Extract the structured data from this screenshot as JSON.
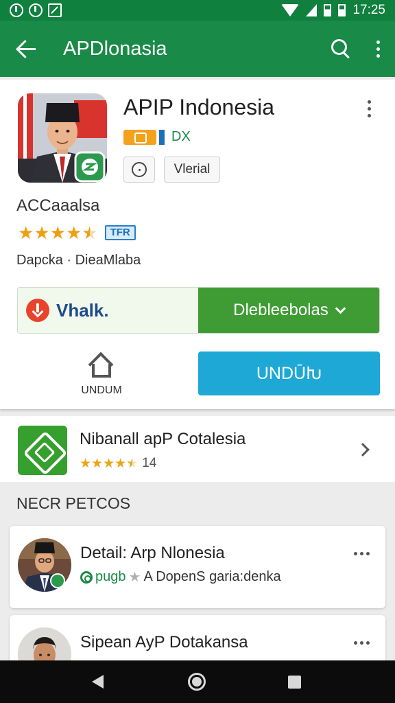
{
  "status_bar": {
    "time": "17:25"
  },
  "app_bar": {
    "title": "APDlonasia"
  },
  "app": {
    "title": "APIP Indonesia",
    "developer": "DX",
    "chip_text": "Vlerial",
    "rating_label": "ACCaaalsa",
    "stars": 4.5,
    "rating_badge": "TFR",
    "meta": "Dapcka · DieaMlaba"
  },
  "actions": {
    "split_left_label": "Vhalk.",
    "split_right_label": "Dlebleebolas",
    "home_label": "UNDUM",
    "install_label": "UNDŪԽ"
  },
  "similar": {
    "title": "Nibanall apP Cotalesia",
    "stars": 4.5,
    "count": "14"
  },
  "section_heading": "NECR PETCOS",
  "list": [
    {
      "title": "Detail: Arp Nlonesia",
      "sub_green": "pugb",
      "sub_text": "A DopenS garia:denka"
    },
    {
      "title": "Sipean AyP Dotakansa",
      "sub_green": "",
      "sub_text": ""
    }
  ],
  "colors": {
    "status_bar": "#10803f",
    "app_bar": "#1a8a48",
    "combo_green": "#3f9c35",
    "install_blue": "#1ea8d6",
    "star": "#f39c12"
  },
  "icons": {
    "status_left": [
      "circle-status-icon",
      "circle-status-icon",
      "n-box-icon"
    ],
    "status_right": [
      "wifi-icon",
      "signal-icon",
      "battery-icon",
      "battery-icon"
    ],
    "app_bar": [
      "back-arrow-icon",
      "search-icon",
      "more-vert-icon"
    ]
  }
}
